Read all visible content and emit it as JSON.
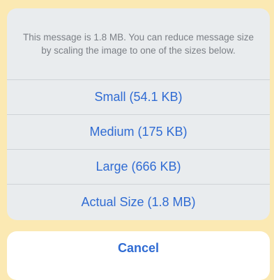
{
  "action_sheet": {
    "message": "This message is 1.8 MB. You can reduce message size by scaling the image to one of the sizes below.",
    "options": [
      {
        "label": "Small (54.1 KB)"
      },
      {
        "label": "Medium (175 KB)"
      },
      {
        "label": "Large (666 KB)"
      },
      {
        "label": "Actual Size (1.8 MB)"
      }
    ],
    "cancel_label": "Cancel"
  },
  "colors": {
    "background": "#fbe9b3",
    "sheet": "#e9ecee",
    "accent": "#2f6bd3",
    "message_text": "#7b7f85"
  }
}
